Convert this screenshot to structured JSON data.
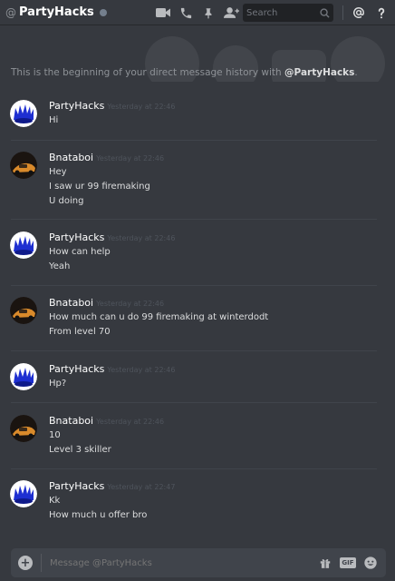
{
  "header": {
    "at": "@",
    "title": "PartyHacks",
    "search_placeholder": "Search",
    "icons": [
      "video-call-icon",
      "voice-call-icon",
      "pin-icon",
      "add-friend-icon",
      "search-icon",
      "mention-icon",
      "help-icon"
    ]
  },
  "intro": {
    "text": "This is the beginning of your direct message history with ",
    "user": "@PartyHacks",
    "end": "."
  },
  "messages": [
    {
      "author": "PartyHacks",
      "time": "Yesterday at 22:46",
      "lines": [
        "Hi"
      ]
    },
    {
      "author": "Bnataboi",
      "time": "Yesterday at 22:46",
      "lines": [
        "Hey",
        "I saw ur 99 firemaking",
        "U doing"
      ]
    },
    {
      "author": "PartyHacks",
      "time": "Yesterday at 22:46",
      "lines": [
        "How can help",
        "Yeah"
      ]
    },
    {
      "author": "Bnataboi",
      "time": "Yesterday at 22:46",
      "lines": [
        "How much can u do 99 firemaking at winterdodt",
        "From level 70"
      ]
    },
    {
      "author": "PartyHacks",
      "time": "Yesterday at 22:46",
      "lines": [
        "Hp?"
      ]
    },
    {
      "author": "Bnataboi",
      "time": "Yesterday at 22:46",
      "lines": [
        "10",
        "Level 3 skiller"
      ]
    },
    {
      "author": "PartyHacks",
      "time": "Yesterday at 22:47",
      "lines": [
        "Kk",
        "How much u offer bro"
      ]
    }
  ],
  "composer": {
    "placeholder": "Message @PartyHacks",
    "gif_label": "GIF"
  },
  "colors": {
    "background": "#36393f",
    "status_offline": "#747f8d",
    "avatar_crown": "#1e2fd1"
  }
}
